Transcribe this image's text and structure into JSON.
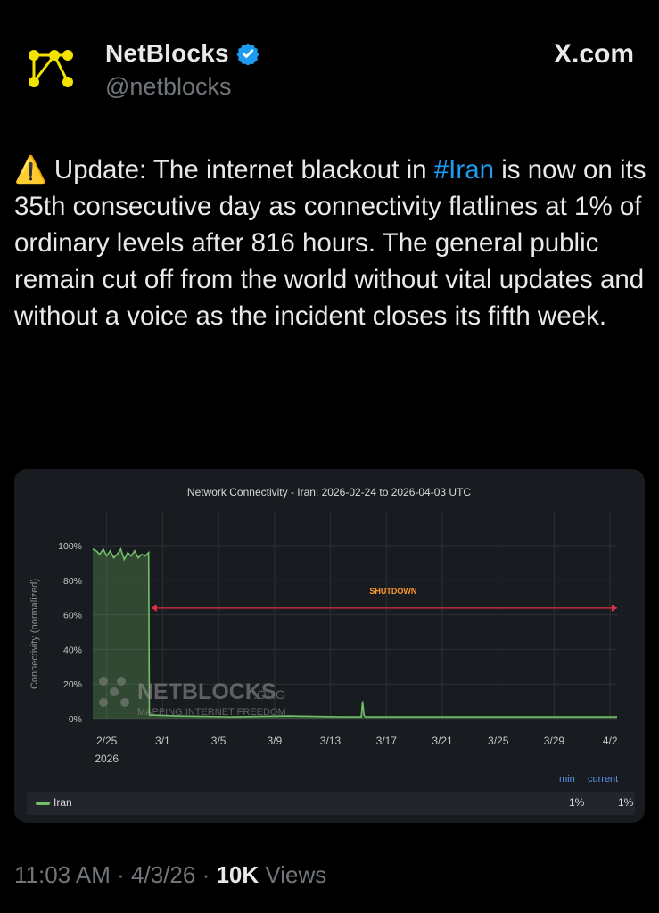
{
  "author": {
    "name": "NetBlocks",
    "handle": "@netblocks",
    "site": "X.com"
  },
  "tweet": {
    "warning_emoji": "⚠️",
    "text_before": " Update: The internet blackout in ",
    "hashtag": "#Iran",
    "text_after": " is now on its 35th consecutive day as connectivity flatlines at 1% of ordinary levels after 816 hours. The general public remain cut off from the world without vital updates and without a voice as the incident closes its fifth week."
  },
  "chart_data": {
    "type": "area",
    "title": "Network Connectivity - Iran: 2026-02-24 to 2026-04-03 UTC",
    "ylabel": "Connectivity (normalized)",
    "ylim": [
      0,
      100
    ],
    "yticks": [
      "0%",
      "20%",
      "40%",
      "60%",
      "80%",
      "100%"
    ],
    "xticks": [
      "2/25",
      "3/1",
      "3/5",
      "3/9",
      "3/13",
      "3/17",
      "3/21",
      "3/25",
      "3/29",
      "4/2"
    ],
    "xtick_sub": "2026",
    "grid": true,
    "series": [
      {
        "name": "Iran",
        "color": "#73bf69",
        "x": [
          0,
          0.25,
          0.5,
          0.75,
          1.0,
          1.25,
          1.5,
          1.75,
          2.0,
          2.25,
          2.5,
          2.75,
          3.0,
          3.25,
          3.5,
          3.75,
          4.0,
          4.05,
          4.3,
          6,
          10,
          14,
          18,
          19.2,
          19.3,
          19.4,
          19.5,
          24,
          30,
          37.5
        ],
        "values": [
          98,
          97,
          95,
          98,
          94,
          97,
          93,
          95,
          98,
          92,
          96,
          94,
          97,
          93,
          95,
          94,
          96,
          2,
          2,
          1.5,
          1,
          1.5,
          1,
          1,
          10,
          2,
          1,
          1,
          1,
          1
        ]
      }
    ],
    "annotation": {
      "label": "SHUTDOWN",
      "color": "#e02f44",
      "x_start": 4.2,
      "x_end": 37.5,
      "y": 64
    },
    "watermark": {
      "name": "NETBLOCKS",
      "suffix": ".ORG",
      "tagline": "MAPPING INTERNET FREEDOM"
    },
    "legend": {
      "headers": [
        "min",
        "current"
      ],
      "rows": [
        {
          "name": "Iran",
          "min": "1%",
          "current": "1%"
        }
      ]
    }
  },
  "footer": {
    "time": "11:03 AM",
    "date": "4/3/26",
    "sep": " · ",
    "views_count": "10K",
    "views_label": "Views"
  },
  "colors": {
    "background": "#000000",
    "text": "#e7e9ea",
    "muted": "#71767b",
    "link": "#1d9bf0",
    "verified": "#1d9bf0",
    "logo": "#f2e400"
  }
}
